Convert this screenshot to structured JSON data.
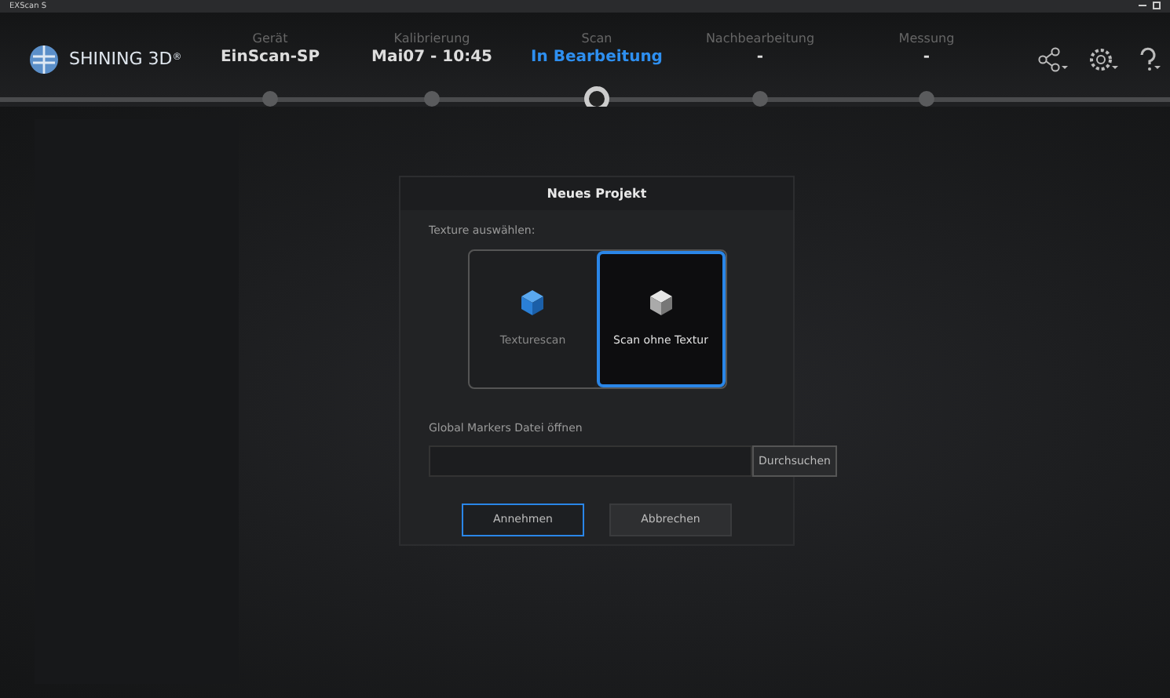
{
  "window": {
    "title": "EXScan S"
  },
  "brand": {
    "name": "SHINING 3D",
    "mark": "®"
  },
  "steps": [
    {
      "label": "Gerät",
      "value": "EinScan-SP",
      "selected": false
    },
    {
      "label": "Kalibrierung",
      "value": "Mai07 - 10:45",
      "selected": false
    },
    {
      "label": "Scan",
      "value": "In Bearbeitung",
      "selected": true
    },
    {
      "label": "Nachbearbeitung",
      "value": "-",
      "selected": false
    },
    {
      "label": "Messung",
      "value": "-",
      "selected": false
    }
  ],
  "dialog": {
    "title": "Neues Projekt",
    "texture_label": "Texture auswählen:",
    "options": [
      {
        "label": "Texturescan",
        "kind": "texture",
        "selected": false
      },
      {
        "label": "Scan ohne Textur",
        "kind": "plain",
        "selected": true
      }
    ],
    "markers_label": "Global Markers Datei öffnen",
    "browse": "Durchsuchen",
    "buttons": [
      {
        "label": "Annehmen",
        "selected": true
      },
      {
        "label": "Abbrechen",
        "selected": false
      }
    ]
  }
}
